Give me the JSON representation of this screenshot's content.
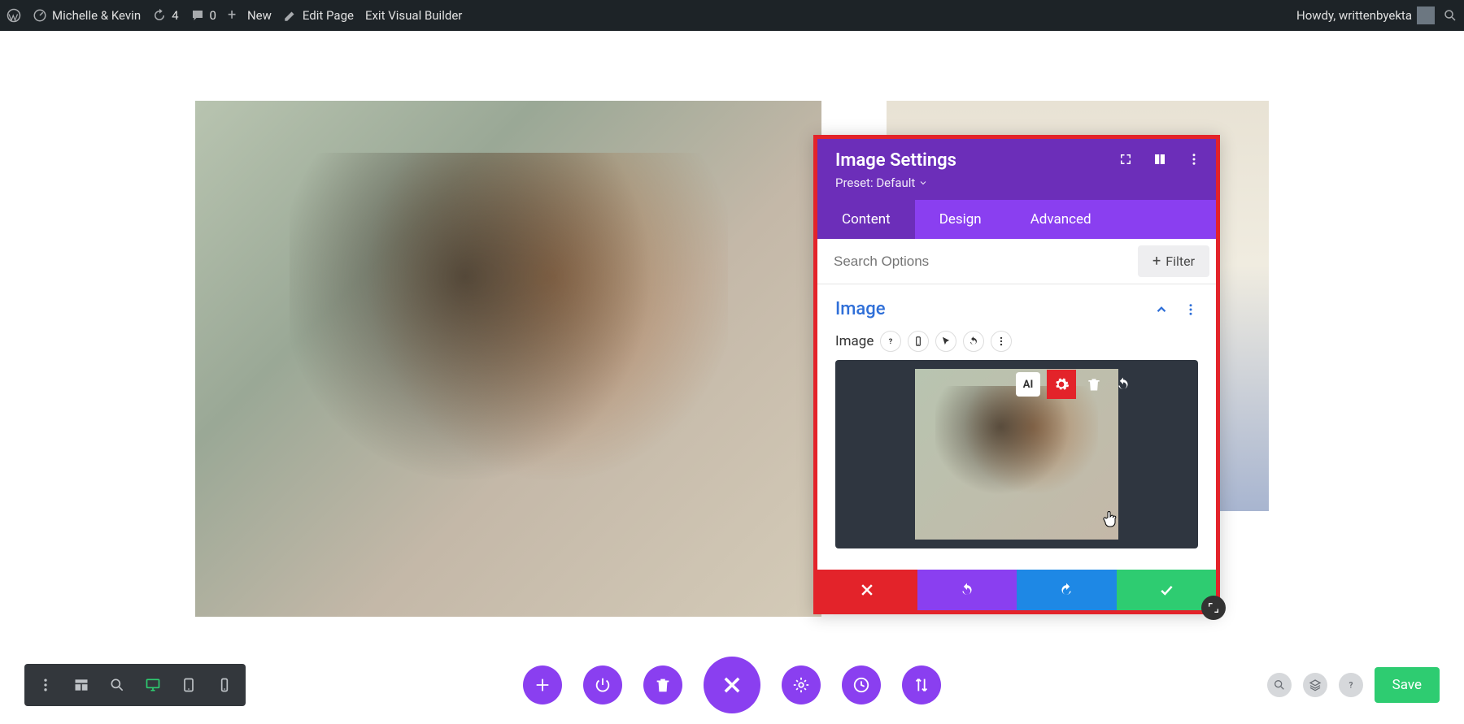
{
  "admin_bar": {
    "site_name": "Michelle & Kevin",
    "updates_count": "4",
    "comments_count": "0",
    "new_label": "New",
    "edit_page": "Edit Page",
    "exit_vb": "Exit Visual Builder",
    "greeting": "Howdy, writtenbyekta"
  },
  "settings": {
    "title": "Image Settings",
    "preset_label": "Preset: Default",
    "tabs": {
      "content": "Content",
      "design": "Design",
      "advanced": "Advanced"
    },
    "search_placeholder": "Search Options",
    "filter_label": "Filter",
    "group_title": "Image",
    "control_label": "Image",
    "ai_label": "AI"
  },
  "bottom": {
    "save": "Save"
  }
}
